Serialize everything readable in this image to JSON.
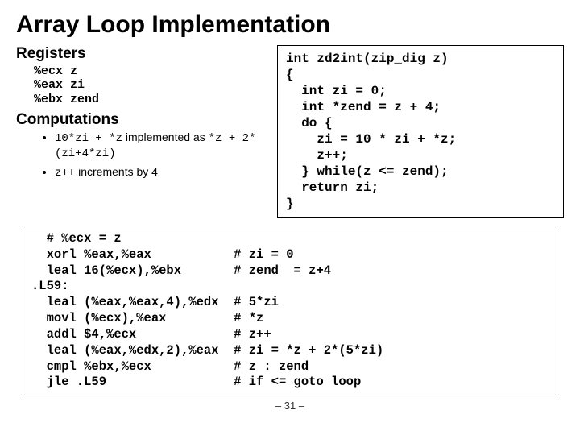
{
  "title": "Array Loop Implementation",
  "registers": {
    "heading": "Registers",
    "lines": [
      "%ecx z",
      "%eax zi",
      "%ebx zend"
    ]
  },
  "computations": {
    "heading": "Computations",
    "item1_a": "10*zi + *z",
    "item1_b": "implemented as",
    "item1_c": "*z + 2*(zi+4*zi)",
    "item2_a": "z++",
    "item2_b": "increments by 4"
  },
  "c_code": "int zd2int(zip_dig z)\n{\n  int zi = 0;\n  int *zend = z + 4;\n  do {\n    zi = 10 * zi + *z;\n    z++;\n  } while(z <= zend);\n  return zi;\n}",
  "asm": "  # %ecx = z\n  xorl %eax,%eax           # zi = 0\n  leal 16(%ecx),%ebx       # zend  = z+4\n.L59:\n  leal (%eax,%eax,4),%edx  # 5*zi\n  movl (%ecx),%eax         # *z\n  addl $4,%ecx             # z++\n  leal (%eax,%edx,2),%eax  # zi = *z + 2*(5*zi)\n  cmpl %ebx,%ecx           # z : zend\n  jle .L59                 # if <= goto loop",
  "pagenum": "– 31 –"
}
